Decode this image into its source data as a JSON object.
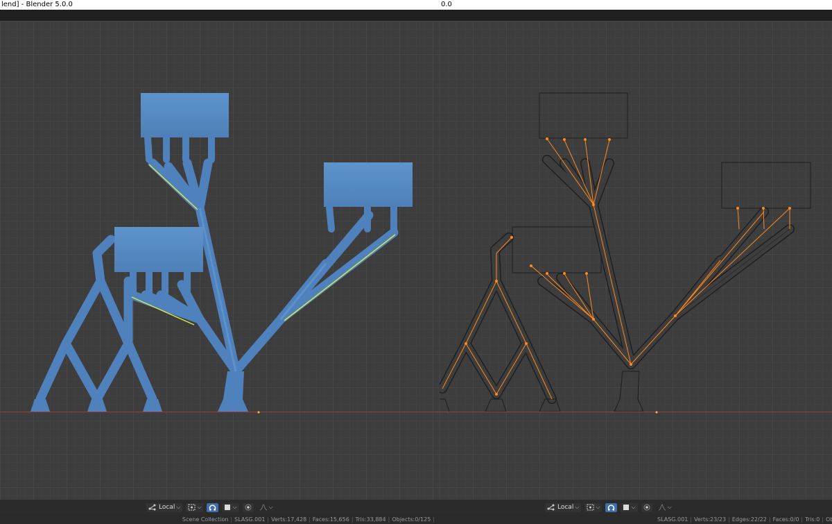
{
  "left_window": {
    "title": "lend] - Blender 5.0.0",
    "header": {
      "transform_orientation": "Local"
    },
    "status": {
      "collection": "Scene Collection",
      "object": "SLASG.001",
      "verts": "Verts:17,428",
      "faces": "Faces:15,656",
      "tris": "Tris:33,884",
      "objects": "Objects:0/125"
    }
  },
  "right_window": {
    "title": "0.0",
    "header": {
      "transform_orientation": "Local"
    },
    "status": {
      "object": "SLASG.001",
      "verts": "Verts:23/23",
      "edges": "Edges:22/22",
      "faces": "Faces:0/0",
      "tris": "Tris:0",
      "objects": "Objects:1"
    }
  },
  "colors": {
    "solid_blue": "#5b8dc4",
    "wire": "#1c1c1c",
    "orange": "#ff8a1f",
    "axis_red": "#9b3b3b",
    "highlight": "#d4e64a"
  },
  "icons": [
    "transform-orientation-icon",
    "pivot-icon",
    "snap-icon",
    "snap-target-icon",
    "proportional-edit-icon",
    "falloff-icon"
  ]
}
